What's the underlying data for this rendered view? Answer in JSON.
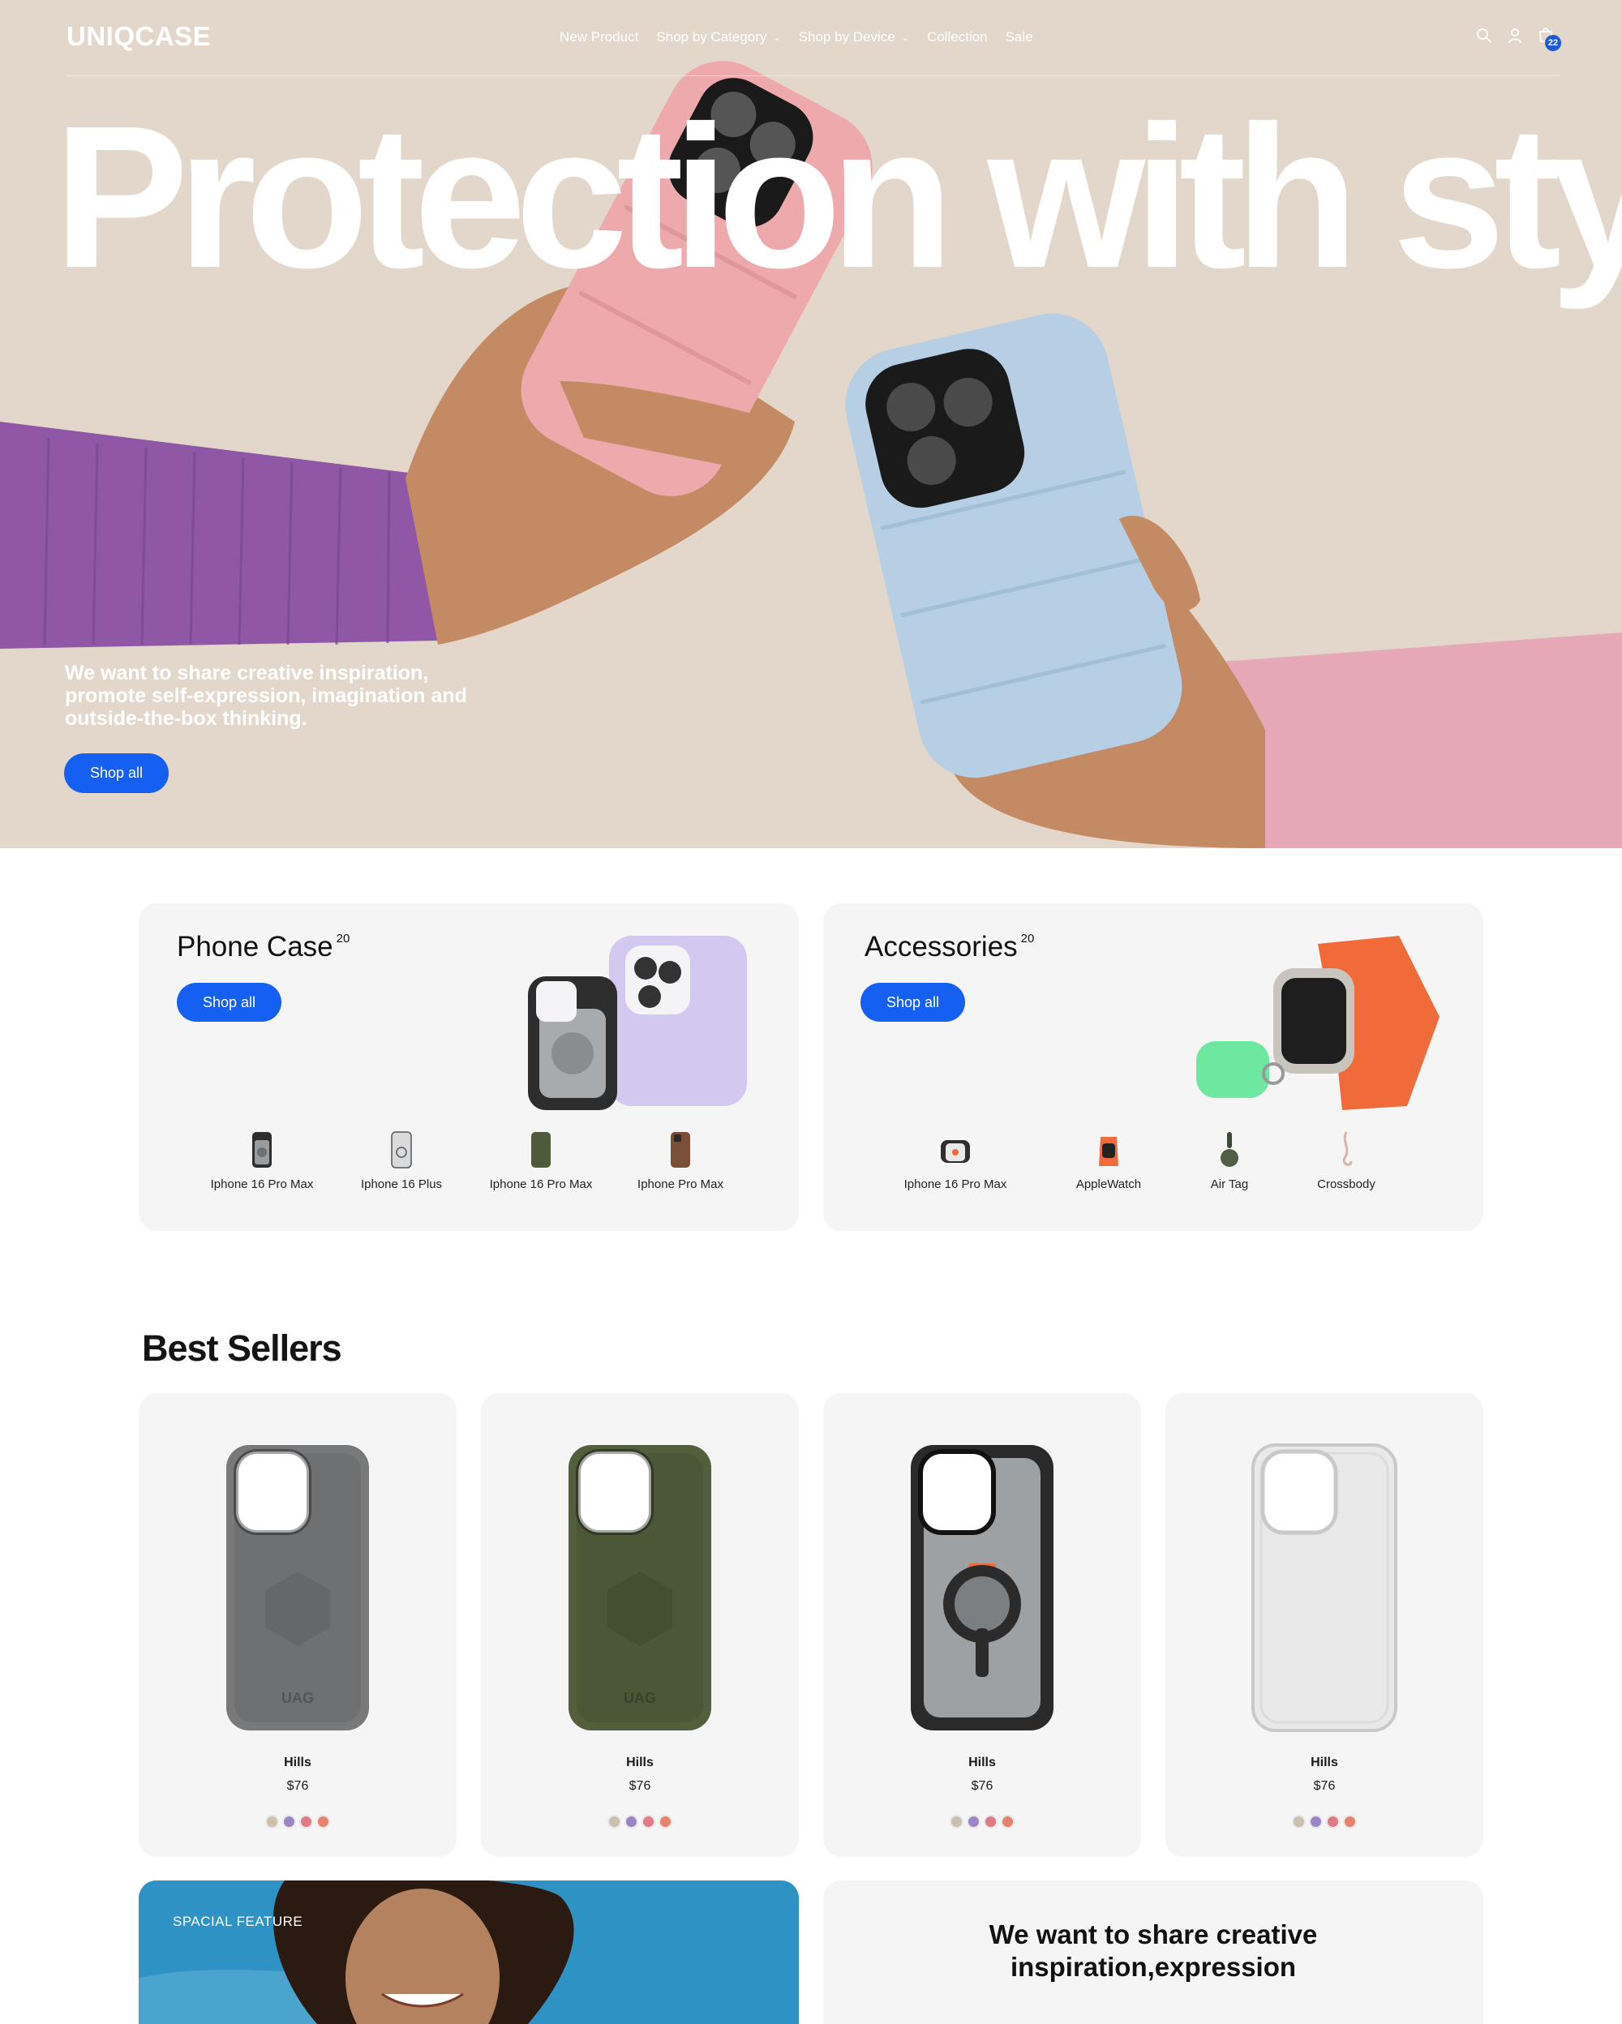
{
  "brand": {
    "logo": "UNIQCASE"
  },
  "nav": {
    "items": [
      {
        "label": "New Product",
        "has_dropdown": false
      },
      {
        "label": "Shop by Category",
        "has_dropdown": true
      },
      {
        "label": "Shop by Device",
        "has_dropdown": true
      },
      {
        "label": "Collection",
        "has_dropdown": false
      },
      {
        "label": "Sale",
        "has_dropdown": false
      }
    ],
    "icons": [
      "search-icon",
      "user-icon",
      "cart-icon"
    ],
    "cart_count": "22"
  },
  "hero": {
    "title": "Protection with style",
    "copy": "We want to share creative inspiration, promote self-expression, imagination and outside-the-box thinking.",
    "button": "Shop all"
  },
  "categories": [
    {
      "title": "Phone Case",
      "count": "20",
      "button": "Shop all",
      "items": [
        {
          "label": "Iphone 16 Pro Max"
        },
        {
          "label": "Iphone 16 Plus"
        },
        {
          "label": "Iphone 16 Pro Max"
        },
        {
          "label": "Iphone Pro Max"
        }
      ]
    },
    {
      "title": "Accessories",
      "count": "20",
      "button": "Shop all",
      "items": [
        {
          "label": "Iphone 16 Pro Max"
        },
        {
          "label": "AppleWatch"
        },
        {
          "label": "Air Tag"
        },
        {
          "label": "Crossbody"
        }
      ]
    }
  ],
  "best_sellers": {
    "title": "Best Sellers",
    "products": [
      {
        "name": "Hills",
        "price": "$76",
        "case_color": "#77797b"
      },
      {
        "name": "Hills",
        "price": "$76",
        "case_color": "#525e3c"
      },
      {
        "name": "Hills",
        "price": "$76",
        "case_color": "#2a2a2a"
      },
      {
        "name": "Hills",
        "price": "$76",
        "case_color": "#e9e9ea"
      }
    ],
    "swatch_colors": [
      "#cbbfae",
      "#9b86c4",
      "#e07b86",
      "#e8826f"
    ]
  },
  "feature": {
    "label": "SPACIAL FEATURE"
  },
  "quote": {
    "line1": "We want to share creative",
    "line2": "inspiration,expression"
  },
  "colors": {
    "accent": "#1560f2",
    "hero_bg": "#e2d7ca",
    "card_bg": "#f5f5f6"
  }
}
